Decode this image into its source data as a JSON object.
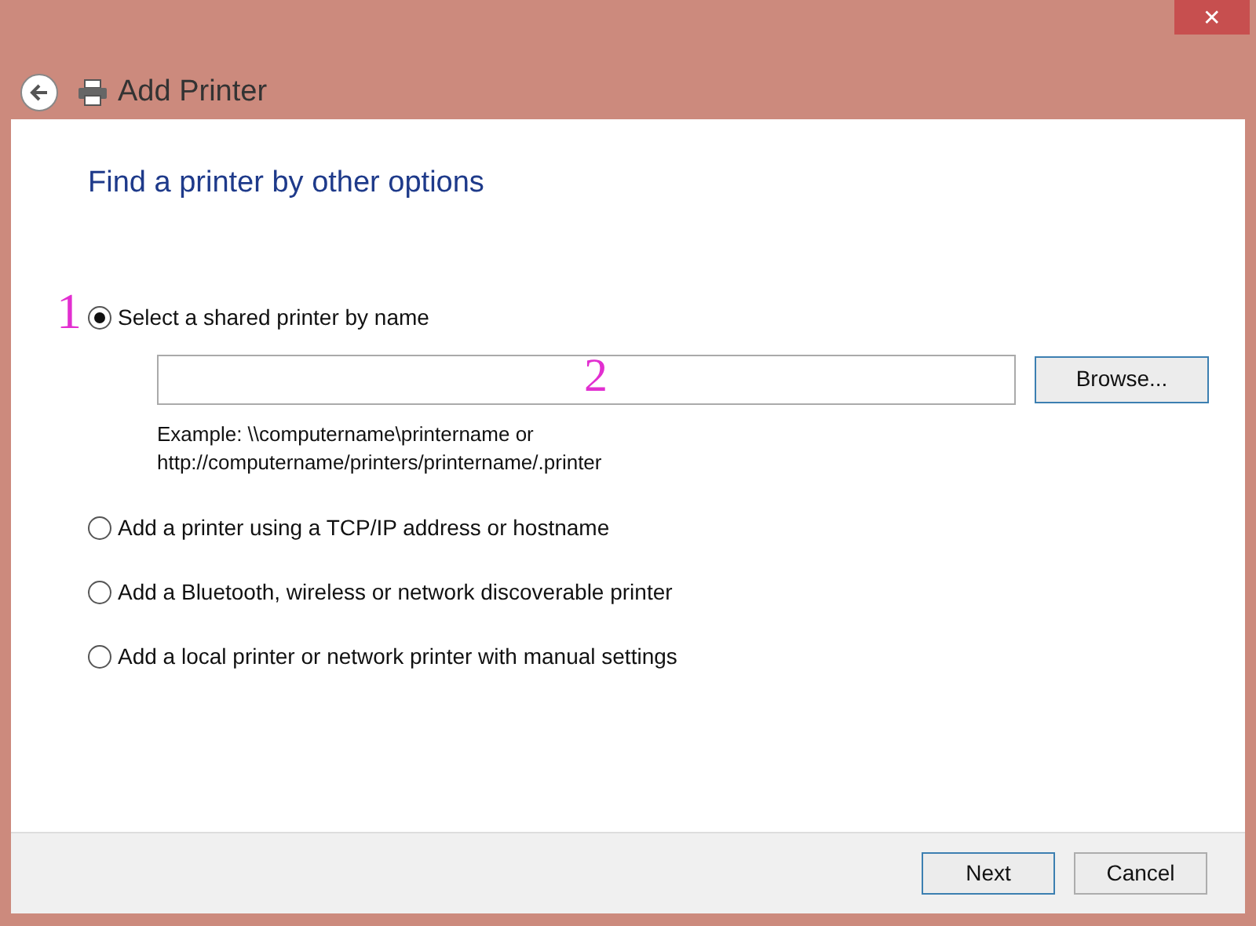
{
  "window": {
    "title": "Add Printer",
    "close": "✕"
  },
  "heading": "Find a printer by other options",
  "options": [
    {
      "label": "Select a shared printer by name",
      "selected": true
    },
    {
      "label": "Add a printer using a TCP/IP address or hostname",
      "selected": false
    },
    {
      "label": "Add a Bluetooth, wireless or network discoverable printer",
      "selected": false
    },
    {
      "label": "Add a local printer or network printer with manual settings",
      "selected": false
    }
  ],
  "browse_button": "Browse...",
  "example": [
    "Example: \\\\computername\\printername or",
    "http://computername/printers/printername/.printer"
  ],
  "annotations": [
    "1",
    "2"
  ],
  "buttons": [
    {
      "label": "Next",
      "focused": true
    },
    {
      "label": "Cancel",
      "focused": false
    }
  ]
}
